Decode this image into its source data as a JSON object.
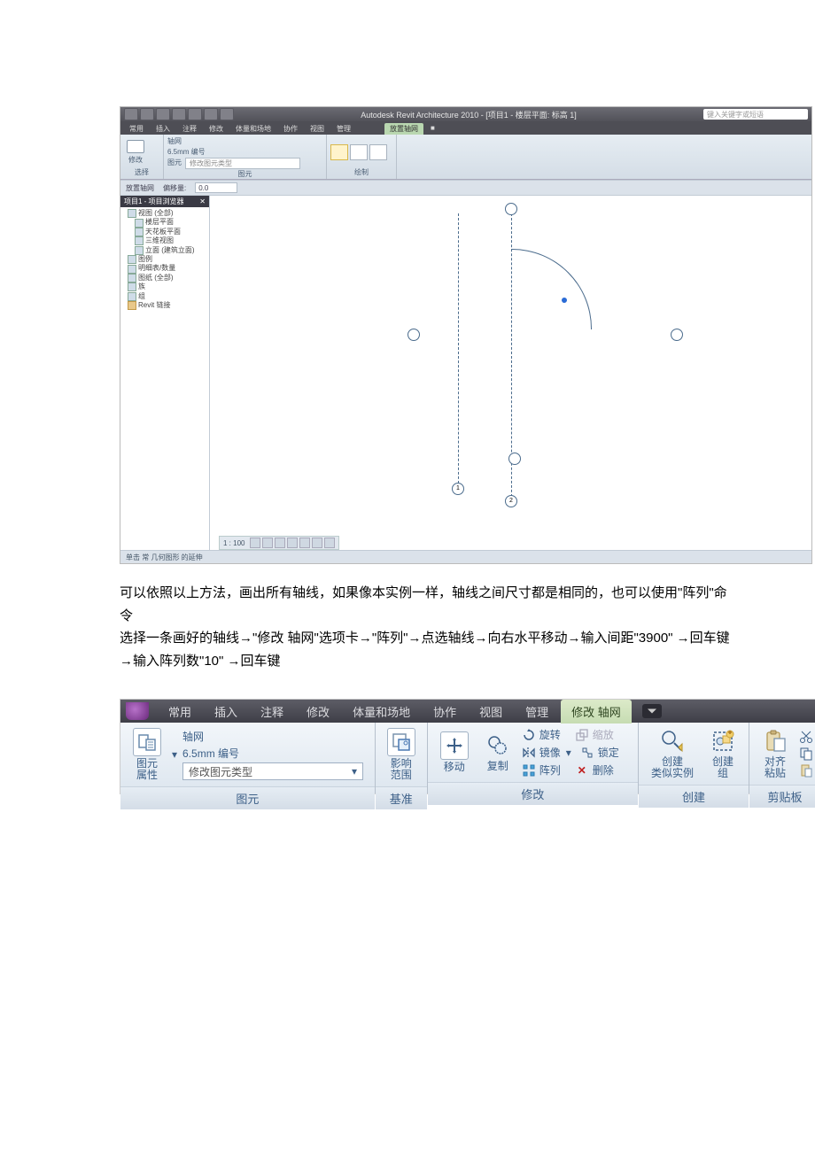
{
  "shot": {
    "title": "Autodesk Revit Architecture 2010 - [项目1 - 楼层平面: 标高 1]",
    "search_placeholder": "键入关键字或短语",
    "tabs": [
      "常用",
      "插入",
      "注释",
      "修改",
      "体量和场地",
      "协作",
      "视图",
      "管理"
    ],
    "active_tab": "放置轴网",
    "extra_tab": "■",
    "group_select": "选择",
    "btn_modify": "修改",
    "type_label_1": "轴网",
    "type_label_2": "6.5mm 编号",
    "type_prop": "图元",
    "type_link": "修改图元类型",
    "group_element": "图元",
    "group_draw": "绘制",
    "options_label": "放置轴网",
    "options_offset_label": "偏移量:",
    "options_offset_value": "0.0",
    "browser_title": "项目1 - 项目浏览器",
    "browser_close": "✕",
    "tree": [
      "视图 (全部)",
      "楼层平面",
      "天花板平面",
      "三维视图",
      "立面 (建筑立面)",
      "图例",
      "明细表/数量",
      "图纸 (全部)",
      "族",
      "组",
      "Revit 链接"
    ],
    "bubble1": "1",
    "bubble2": "2",
    "view_scale": "1 : 100",
    "status": "单击 常 几何图形 的延伸"
  },
  "para1": "可以依照以上方法，画出所有轴线，如果像本实例一样，轴线之间尺寸都是相同的，也可以使用\"阵列\"命令",
  "para2": "选择一条画好的轴线→\"修改 轴网\"选项卡→\"阵列\"→点选轴线→向右水平移动→输入间距\"3900\" →回车键→输入阵列数\"10\" →回车键",
  "ribbon2": {
    "tabs": [
      "常用",
      "插入",
      "注释",
      "修改",
      "体量和场地",
      "协作",
      "视图",
      "管理"
    ],
    "active_tab": "修改 轴网",
    "g_element": {
      "btn": "图元\n属性",
      "type_l1": "轴网",
      "type_l2": "6.5mm 编号",
      "type_link": "修改图元类型",
      "label": "图元"
    },
    "g_datum": {
      "btn": "影响\n范围",
      "label": "基准"
    },
    "g_modify": {
      "move": "移动",
      "copy": "复制",
      "rotate": "旋转",
      "scale": "缩放",
      "mirror": "镜像",
      "pin": "锁定",
      "array": "阵列",
      "delete": "删除",
      "label": "修改"
    },
    "g_create": {
      "similar": "创建\n类似实例",
      "group": "创建\n组",
      "label": "创建"
    },
    "g_clip": {
      "align": "对齐\n粘贴",
      "label": "剪贴板"
    }
  }
}
